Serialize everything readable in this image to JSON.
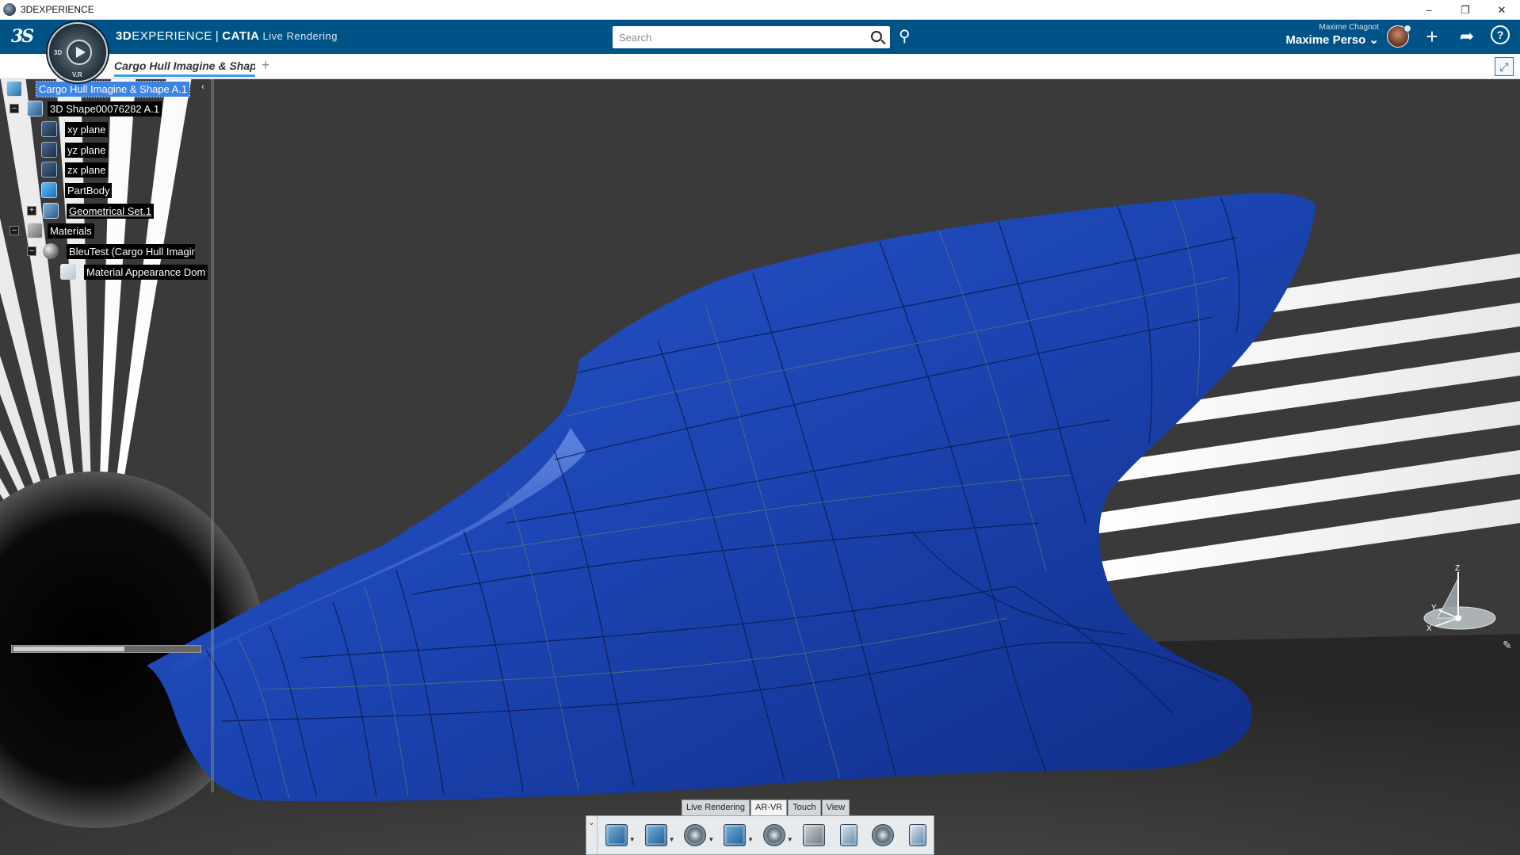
{
  "window": {
    "title": "3DEXPERIENCE"
  },
  "header": {
    "brand_3d": "3D",
    "brand_experience": "EXPERIENCE",
    "brand_sep": "|",
    "brand_app": "CATIA",
    "brand_role": "Live Rendering",
    "compass_labels": {
      "left": "3D",
      "bottom": "V.R"
    },
    "search_placeholder": "Search",
    "user_small": "Maxime Chagnot",
    "user_name": "Maxime Perso ⌄"
  },
  "tabs": [
    {
      "label": "Cargo Hull Imagine & Shape"
    }
  ],
  "tree": {
    "nodes": [
      {
        "label": "Cargo Hull Imagine & Shape A.1",
        "icon": "product-icon",
        "selected": true
      },
      {
        "label": "3D Shape00076282 A.1",
        "icon": "shape-icon"
      },
      {
        "label": "xy plane",
        "icon": "plane-icon"
      },
      {
        "label": "yz plane",
        "icon": "plane-icon"
      },
      {
        "label": "zx plane",
        "icon": "plane-icon"
      },
      {
        "label": "PartBody",
        "icon": "partbody-icon"
      },
      {
        "label": "Geometrical Set.1",
        "icon": "geometrical-set-icon"
      },
      {
        "label": "Materials",
        "icon": "folder-icon"
      },
      {
        "label": "BleuTest (Cargo Hull Imagine",
        "icon": "material-icon"
      },
      {
        "label": "Material Appearance Dom",
        "icon": "appearance-domain-icon"
      }
    ]
  },
  "triad": {
    "z": "Z",
    "y": "Y",
    "x": "X"
  },
  "action_bar": {
    "tabs": [
      "Live Rendering",
      "AR-VR",
      "Touch",
      "View"
    ],
    "active_tab": "AR-VR",
    "commands": [
      "render-setup-icon",
      "capture-icon",
      "environment-gear-icon",
      "stage-icon",
      "lights-gear-icon",
      "camera-icon",
      "render-doc-icon",
      "animation-icon",
      "export-doc-icon"
    ]
  },
  "colors": {
    "header": "#005386",
    "hull": "#1e48b8",
    "selection": "#3d83e6",
    "tab_underline": "#3aa0d8"
  }
}
